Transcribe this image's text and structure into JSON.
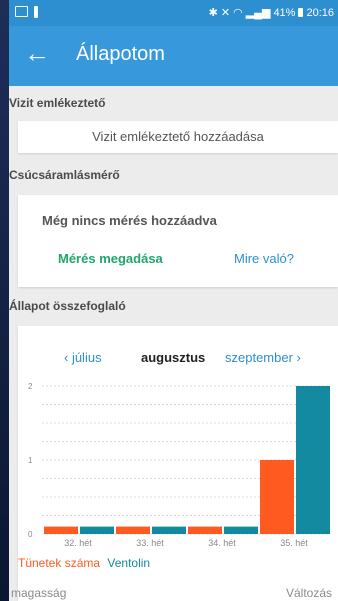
{
  "status_bar": {
    "battery": "41%",
    "time": "20:16"
  },
  "app_bar": {
    "back_icon": "arrow-left-icon",
    "title": "Állapotom"
  },
  "visit_reminder": {
    "section_label": "Vizit emlékeztető",
    "add_button": "Vizit emlékeztető hozzáadása"
  },
  "peak_flow": {
    "section_label": "Csúcsáramlásmérő",
    "empty_message": "Még nincs mérés hozzáadva",
    "add_measurement": "Mérés megadása",
    "what_for": "Mire való?"
  },
  "summary": {
    "section_label": "Állapot összefoglaló",
    "prev_month": "‹  július",
    "current_month": "augusztus",
    "next_month": "szeptember  ›"
  },
  "colors": {
    "accent": "#3799db",
    "series_symptoms": "#ff5a1f",
    "series_ventolin": "#138aa0",
    "green": "#21a66b"
  },
  "chart_data": {
    "type": "bar",
    "categories": [
      "32. hét",
      "33. hét",
      "34. hét",
      "35. hét"
    ],
    "series": [
      {
        "name": "Tünetek száma",
        "values": [
          0.1,
          0.1,
          0.1,
          1.0
        ]
      },
      {
        "name": "Ventolin",
        "values": [
          0.1,
          0.1,
          0.1,
          2.0
        ]
      }
    ],
    "ylim": [
      0,
      2
    ],
    "yticks": [
      "0",
      "1",
      "2"
    ],
    "grid": true,
    "legend": "bottom-left"
  },
  "footer": {
    "left": "magasság",
    "right": "Változás"
  }
}
